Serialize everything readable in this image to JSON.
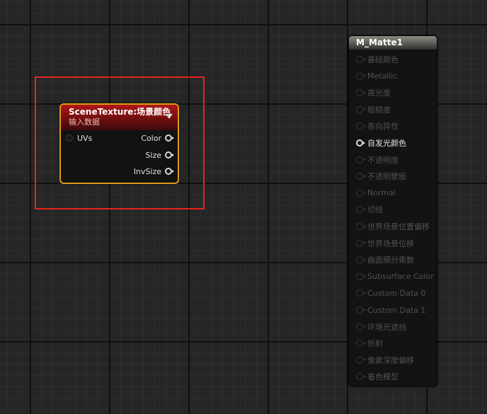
{
  "scene_texture_node": {
    "title": "SceneTexture:场景颜色",
    "subtitle": "输入数据",
    "inputs": [
      {
        "label": "UVs"
      }
    ],
    "outputs": [
      {
        "label": "Color"
      },
      {
        "label": "Size"
      },
      {
        "label": "InvSize"
      }
    ]
  },
  "material_node": {
    "title": "M_Matte1",
    "inputs": [
      {
        "label": "基础颜色",
        "active": false
      },
      {
        "label": "Metallic",
        "active": false
      },
      {
        "label": "高光度",
        "active": false
      },
      {
        "label": "粗糙度",
        "active": false
      },
      {
        "label": "各向异性",
        "active": false
      },
      {
        "label": "自发光颜色",
        "active": true
      },
      {
        "label": "不透明度",
        "active": false
      },
      {
        "label": "不透明蒙版",
        "active": false
      },
      {
        "label": "Normal",
        "active": false
      },
      {
        "label": "切线",
        "active": false
      },
      {
        "label": "世界场景位置偏移",
        "active": false
      },
      {
        "label": "世界场景位移",
        "active": false
      },
      {
        "label": "曲面细分乘数",
        "active": false
      },
      {
        "label": "Subsurface Color",
        "active": false
      },
      {
        "label": "Custom Data 0",
        "active": false
      },
      {
        "label": "Custom Data 1",
        "active": false
      },
      {
        "label": "环境光遮挡",
        "active": false
      },
      {
        "label": "折射",
        "active": false
      },
      {
        "label": "像素深度偏移",
        "active": false
      },
      {
        "label": "着色模型",
        "active": false
      }
    ]
  },
  "colors": {
    "canvas_background": "#262626",
    "selection_outline": "#e8221e",
    "node_selected_border": "#e09a18",
    "scene_texture_header": "#b01818",
    "material_header": "#8a8a80"
  }
}
